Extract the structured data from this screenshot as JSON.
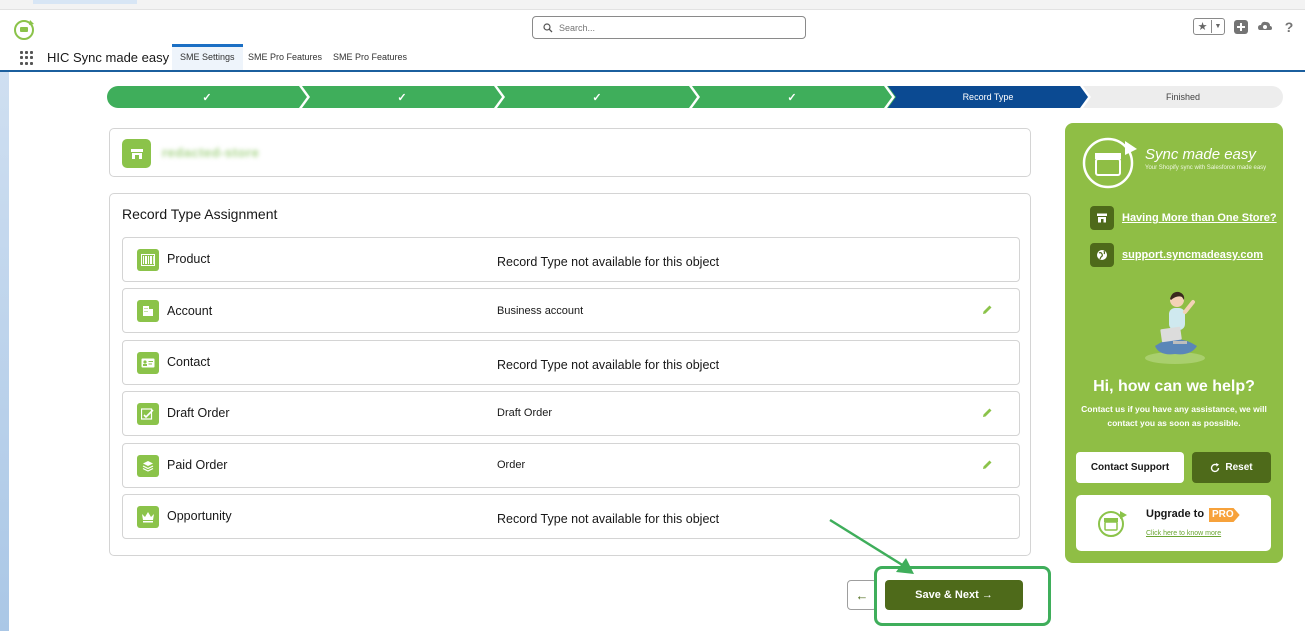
{
  "header": {
    "search_placeholder": "Search...",
    "help_label": "?"
  },
  "nav": {
    "app_name": "HIC Sync made easy",
    "tabs": [
      {
        "label": "SME Settings",
        "active": true
      },
      {
        "label": "SME Pro Features",
        "active": false
      },
      {
        "label": "SME Pro Features",
        "active": false
      }
    ]
  },
  "progress": {
    "steps": [
      {
        "label": "✓",
        "state": "done"
      },
      {
        "label": "✓",
        "state": "done"
      },
      {
        "label": "✓",
        "state": "done"
      },
      {
        "label": "✓",
        "state": "done"
      },
      {
        "label": "✓",
        "state": "done"
      },
      {
        "label": "Record Type",
        "state": "current"
      },
      {
        "label": "Finished",
        "state": "todo"
      }
    ]
  },
  "store": {
    "icon": "store-icon"
  },
  "assignment": {
    "title": "Record Type Assignment",
    "rows": [
      {
        "label": "Product",
        "value": "Record Type not available for this object",
        "editable": false,
        "icon": "barcode-icon"
      },
      {
        "label": "Account",
        "value": "Business account",
        "editable": true,
        "icon": "building-icon"
      },
      {
        "label": "Contact",
        "value": "Record Type not available for this object",
        "editable": false,
        "icon": "contact-card-icon"
      },
      {
        "label": "Draft Order",
        "value": "Draft Order",
        "editable": true,
        "icon": "draft-order-icon"
      },
      {
        "label": "Paid Order",
        "value": "Order",
        "editable": true,
        "icon": "layers-icon"
      },
      {
        "label": "Opportunity",
        "value": "Record Type not available for this object",
        "editable": false,
        "icon": "crown-icon"
      }
    ]
  },
  "footer": {
    "back_icon": "←",
    "save_label": "Save & Next →"
  },
  "sidebar": {
    "brand_title": "Sync made easy",
    "brand_subtitle": "Your Shopify sync with Salesforce made easy",
    "links": [
      {
        "label": "Having More than One Store?",
        "icon": "store-icon"
      },
      {
        "label": "support.syncmadeasy.com",
        "icon": "globe-icon"
      }
    ],
    "help_title": "Hi, how can we help?",
    "help_text": "Contact us if you have any assistance, we will contact you as soon as possible.",
    "contact_label": "Contact Support",
    "reset_label": "Reset",
    "upgrade_label": "Upgrade to",
    "pro_label": "PRO",
    "upgrade_link": "Click here to know more"
  },
  "colors": {
    "accent_green": "#8bc34a",
    "dark_green": "#4e6a1a",
    "step_done": "#3fae5b",
    "step_current": "#0b4a92",
    "nav_underline": "#1b5f9e"
  }
}
